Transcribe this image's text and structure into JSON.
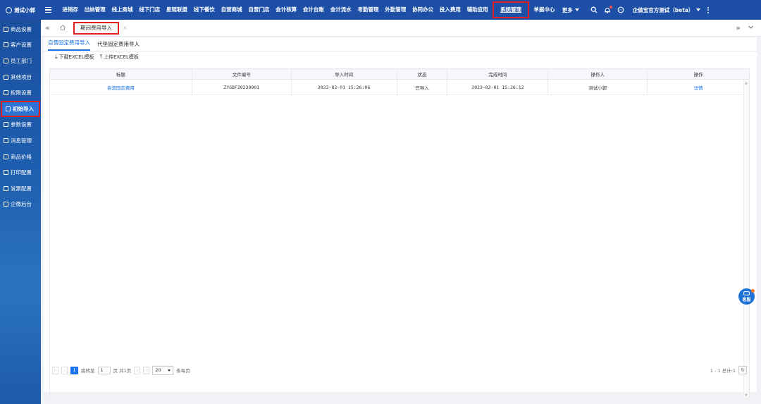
{
  "brand": {
    "name": "测试小郭"
  },
  "nav": {
    "items": [
      "进销存",
      "出纳管理",
      "线上商城",
      "线下门店",
      "星链联盟",
      "线下餐饮",
      "自营商城",
      "自营门店",
      "会计核算",
      "会计台账",
      "会计流水",
      "考勤管理",
      "外勤管理",
      "协同办公",
      "投入费用",
      "辅助应用",
      "系统管理",
      "单据中心"
    ],
    "active_index": 16,
    "more": "更多",
    "company": "企做宝官方测试（beta）"
  },
  "sidebar": {
    "items": [
      "商品设置",
      "客户设置",
      "员工部门",
      "其他项目",
      "权限设置",
      "初始导入",
      "参数设置",
      "消息管理",
      "商品价格",
      "打印配置",
      "发票配置",
      "企微后台"
    ],
    "active_index": 5
  },
  "tabstrip": {
    "page_tab": "期间费用导入",
    "close": "×"
  },
  "subtabs": [
    "自营固定费用导入",
    "代垫固定费用导入"
  ],
  "toolbar": {
    "download": "下载EXCEL模板",
    "upload": "上传EXCEL模板"
  },
  "table": {
    "headers": [
      "标题",
      "文件编号",
      "导入时间",
      "状态",
      "完成时间",
      "操作人",
      "操作"
    ],
    "rows": [
      {
        "title": "自营固定费用",
        "file_no": "ZYGDF20230001",
        "import_time": "2023-02-01 15:26:06",
        "status": "已导入",
        "done_time": "2023-02-01 15:26:12",
        "operator": "测试小郭",
        "action": "详情"
      }
    ]
  },
  "pager": {
    "current": "1",
    "goto_label": "跳转至",
    "goto_value": "1",
    "page_info": "页 共1页",
    "page_size": "20",
    "per_page": "条每页",
    "total": "1 - 1 总计:1"
  },
  "service": {
    "label": "客服"
  },
  "colors": {
    "topbar": "#1c4fa5",
    "accent": "#1a73e8",
    "highlight": "#e02020"
  }
}
